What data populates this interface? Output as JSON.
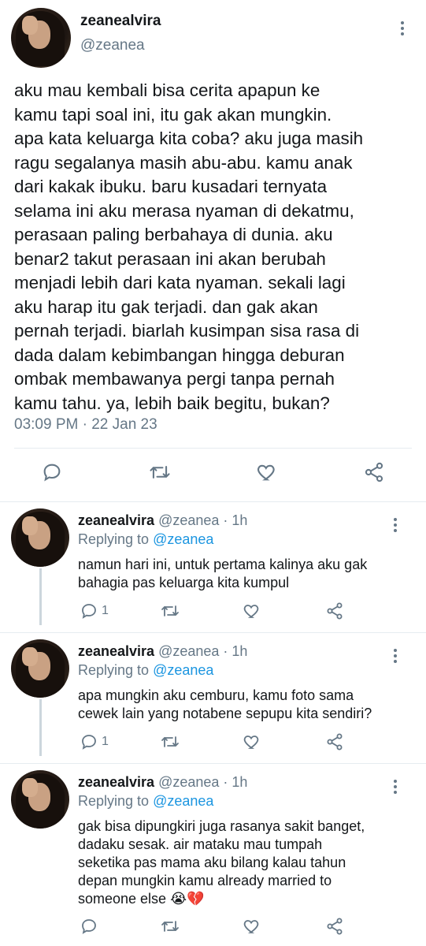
{
  "main_tweet": {
    "display_name": "zeanealvira",
    "handle": "@zeanea",
    "text_lines": [
      "aku mau kembali bisa cerita apapun ke",
      "kamu tapi soal ini, itu gak akan mungkin.",
      "apa kata keluarga kita coba? aku juga masih",
      "ragu segalanya masih abu-abu. kamu anak",
      "dari kakak ibuku. baru kusadari ternyata",
      "selama ini aku merasa nyaman di dekatmu,",
      "perasaan paling berbahaya di dunia. aku",
      "benar2 takut perasaan ini akan berubah",
      "menjadi lebih dari kata nyaman. sekali lagi",
      "aku harap itu gak terjadi. dan gak akan",
      "pernah terjadi. biarlah kusimpan sisa rasa di",
      "dada dalam kebimbangan hingga deburan",
      "ombak membawanya pergi tanpa pernah",
      "kamu tahu. ya, lebih baik begitu, bukan?"
    ],
    "timestamp": "03:09 PM · 22 Jan 23",
    "icons": {
      "reply": "reply-icon",
      "retweet": "retweet-icon",
      "like": "heart-icon",
      "share": "share-icon",
      "more": "more-vertical-icon"
    }
  },
  "replies": [
    {
      "display_name": "zeanealvira",
      "meta": "@zeanea · 1h",
      "replying_prefix": "Replying to ",
      "replying_handle": "@zeanea",
      "text_lines": [
        "namun hari ini, untuk pertama kalinya aku gak",
        "bahagia pas keluarga kita kumpul"
      ],
      "reply_count": "1"
    },
    {
      "display_name": "zeanealvira",
      "meta": "@zeanea · 1h",
      "replying_prefix": "Replying to ",
      "replying_handle": "@zeanea",
      "text_lines": [
        "apa mungkin aku cemburu, kamu foto sama",
        "cewek lain yang notabene sepupu kita sendiri?"
      ],
      "reply_count": "1"
    },
    {
      "display_name": "zeanealvira",
      "meta": "@zeanea · 1h",
      "replying_prefix": "Replying to ",
      "replying_handle": "@zeanea",
      "text_lines": [
        "gak bisa dipungkiri juga rasanya sakit banget,",
        "dadaku sesak. air mataku mau tumpah",
        "seketika pas mama aku bilang kalau tahun",
        "depan mungkin kamu already married to",
        "someone else 😭💔"
      ],
      "reply_count": ""
    }
  ],
  "colors": {
    "text": "#14171a",
    "secondary": "#657786",
    "link": "#1b95e0",
    "divider": "#e6ecf0",
    "thread_line": "#ccd6dd"
  }
}
